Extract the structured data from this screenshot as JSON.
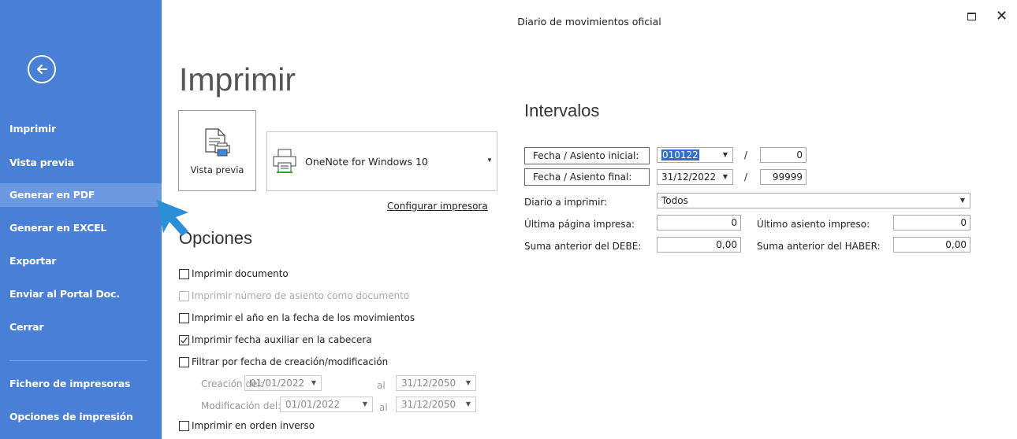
{
  "window": {
    "title": "Diario de movimientos oficial"
  },
  "sidebar": {
    "items": [
      {
        "label": "Imprimir"
      },
      {
        "label": "Vista previa"
      },
      {
        "label": "Generar en PDF"
      },
      {
        "label": "Generar en EXCEL"
      },
      {
        "label": "Exportar"
      },
      {
        "label": "Enviar al Portal Doc."
      },
      {
        "label": "Cerrar"
      },
      {
        "label": "Fichero de impresoras"
      },
      {
        "label": "Opciones de impresión"
      }
    ]
  },
  "main": {
    "title": "Imprimir",
    "preview_label": "Vista previa",
    "printer_name": "OneNote for Windows 10",
    "config_printer": "Configurar impresora"
  },
  "options": {
    "title": "Opciones",
    "checks": [
      {
        "label": "Imprimir documento",
        "checked": false
      },
      {
        "label": "Imprimir número de asiento como documento",
        "checked": false
      },
      {
        "label": "Imprimir el año en la fecha de los movimientos",
        "checked": false
      },
      {
        "label": "Imprimir fecha auxiliar en la cabecera",
        "checked": true
      },
      {
        "label": "Filtrar por fecha de creación/modificación",
        "checked": false
      },
      {
        "label": "Imprimir en orden inverso",
        "checked": false
      }
    ],
    "creation_label": "Creación del:",
    "creation_from": "01/01/2022",
    "creation_al": "al",
    "creation_to": "31/12/2050",
    "modification_label": "Modificación del:",
    "modification_from": "01/01/2022",
    "modification_al": "al",
    "modification_to": "31/12/2050"
  },
  "intervals": {
    "title": "Intervalos",
    "start_label": "Fecha / Asiento inicial:",
    "start_date": "010122",
    "start_slash": "/",
    "start_seat": "0",
    "end_label": "Fecha / Asiento final:",
    "end_date": "31/12/2022",
    "end_slash": "/",
    "end_seat": "99999",
    "diary_label": "Diario a imprimir:",
    "diary_value": "Todos",
    "last_page_label": "Última página impresa:",
    "last_page_value": "0",
    "last_seat_label": "Último asiento impreso:",
    "last_seat_value": "0",
    "debe_label": "Suma anterior del DEBE:",
    "debe_value": "0,00",
    "haber_label": "Suma anterior del HABER:",
    "haber_value": "0,00"
  }
}
